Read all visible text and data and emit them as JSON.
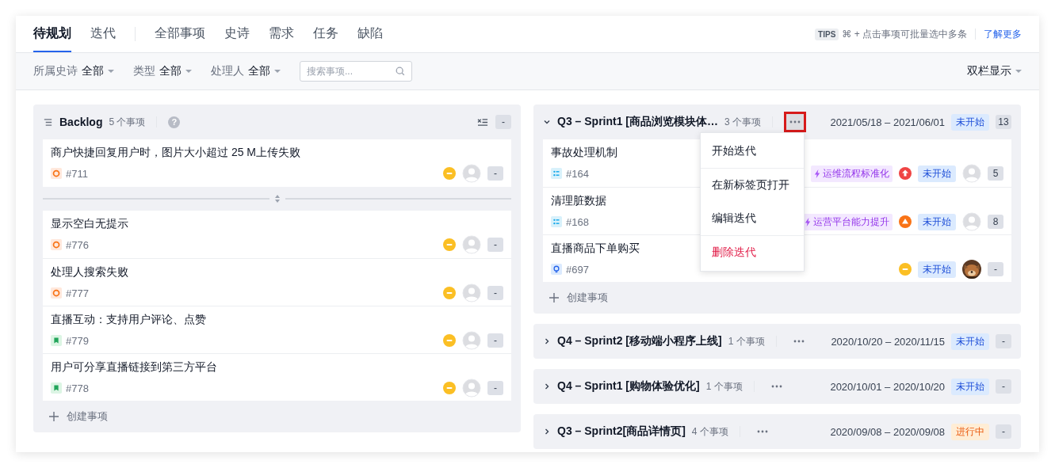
{
  "tabs": [
    {
      "label": "待规划",
      "selected": true
    },
    {
      "label": "迭代",
      "selected": false
    },
    {
      "label": "全部事项",
      "selected": false
    },
    {
      "label": "史诗",
      "selected": false
    },
    {
      "label": "需求",
      "selected": false
    },
    {
      "label": "任务",
      "selected": false
    },
    {
      "label": "缺陷",
      "selected": false
    }
  ],
  "tips": {
    "badge": "TIPS",
    "text": "⌘ + 点击事项可批量选中多条",
    "link": "了解更多"
  },
  "filters": [
    {
      "label": "所属史诗",
      "value": "全部"
    },
    {
      "label": "类型",
      "value": "全部"
    },
    {
      "label": "处理人",
      "value": "全部"
    }
  ],
  "search": {
    "placeholder": "搜索事项..."
  },
  "view_switch": "双栏显示",
  "backlog": {
    "title": "Backlog",
    "count": "5 个事项",
    "help": "?",
    "estimate": "-",
    "create": "创建事项",
    "groups": [
      {
        "items": [
          {
            "title": "商户快捷回复用户时，图片大小超过 25 M上传失败",
            "type": {
              "kind": "bug"
            },
            "id": "#711",
            "priority": {
              "kind": "medium"
            },
            "avatar": {
              "kind": "placeholder"
            },
            "estimate": "-"
          }
        ]
      },
      {
        "items": [
          {
            "title": "显示空白无提示",
            "type": {
              "kind": "bug"
            },
            "id": "#776",
            "priority": {
              "kind": "medium"
            },
            "avatar": {
              "kind": "placeholder"
            },
            "estimate": "-"
          },
          {
            "title": "处理人搜索失败",
            "type": {
              "kind": "bug"
            },
            "id": "#777",
            "priority": {
              "kind": "medium"
            },
            "avatar": {
              "kind": "placeholder"
            },
            "estimate": "-"
          },
          {
            "title": "直播互动：支持用户评论、点赞",
            "type": {
              "kind": "story"
            },
            "id": "#779",
            "priority": {
              "kind": "medium"
            },
            "avatar": {
              "kind": "placeholder"
            },
            "estimate": "-"
          },
          {
            "title": "用户可分享直播链接到第三方平台",
            "type": {
              "kind": "story"
            },
            "id": "#778",
            "priority": {
              "kind": "medium"
            },
            "avatar": {
              "kind": "placeholder"
            },
            "estimate": "-"
          }
        ]
      }
    ]
  },
  "sprints": [
    {
      "title": "Q3 – Sprint1 [商品浏览模块体…",
      "count": "3 个事项",
      "expanded": true,
      "menu_open": true,
      "dates": "2021/05/18 – 2021/06/01",
      "status": {
        "label": "未开始",
        "kind": "todo"
      },
      "estimate": "13",
      "create": "创建事项",
      "items": [
        {
          "title": "事故处理机制",
          "type": {
            "kind": "task"
          },
          "id": "#164",
          "tag": "运维流程标准化",
          "priority": {
            "kind": "high"
          },
          "status": "未开始",
          "avatar": {
            "kind": "placeholder"
          },
          "estimate": "5"
        },
        {
          "title": "清理脏数据",
          "type": {
            "kind": "task"
          },
          "id": "#168",
          "tag": "运营平台能力提升",
          "priority": {
            "kind": "higher"
          },
          "status": "未开始",
          "avatar": {
            "kind": "placeholder"
          },
          "estimate": "8"
        },
        {
          "title": "直播商品下单购买",
          "type": {
            "kind": "idea"
          },
          "id": "#697",
          "priority": {
            "kind": "medium"
          },
          "status": "未开始",
          "estimate": "-"
        }
      ]
    },
    {
      "title": "Q4 – Sprint2 [移动端小程序上线]",
      "count": "1 个事项",
      "expanded": false,
      "menu_open": false,
      "dates": "2020/10/20 – 2020/11/15",
      "status": {
        "label": "未开始",
        "kind": "todo"
      },
      "estimate": "-"
    },
    {
      "title": "Q4 – Sprint1 [购物体验优化]",
      "count": "1 个事项",
      "expanded": false,
      "menu_open": false,
      "dates": "2020/10/01 – 2020/10/20",
      "status": {
        "label": "未开始",
        "kind": "todo"
      },
      "estimate": "-"
    },
    {
      "title": "Q3 – Sprint2[商品详情页]",
      "count": "4 个事项",
      "expanded": false,
      "menu_open": false,
      "dates": "2020/09/08 – 2020/09/08",
      "status": {
        "label": "进行中",
        "kind": "doing"
      },
      "estimate": "-"
    }
  ],
  "sprint_menu": {
    "sections": [
      [
        {
          "label": "开始迭代",
          "kind": "normal"
        }
      ],
      [
        {
          "label": "在新标签页打开",
          "kind": "normal"
        },
        {
          "label": "编辑迭代",
          "kind": "normal"
        }
      ],
      [
        {
          "label": "删除迭代",
          "kind": "danger"
        }
      ]
    ]
  }
}
